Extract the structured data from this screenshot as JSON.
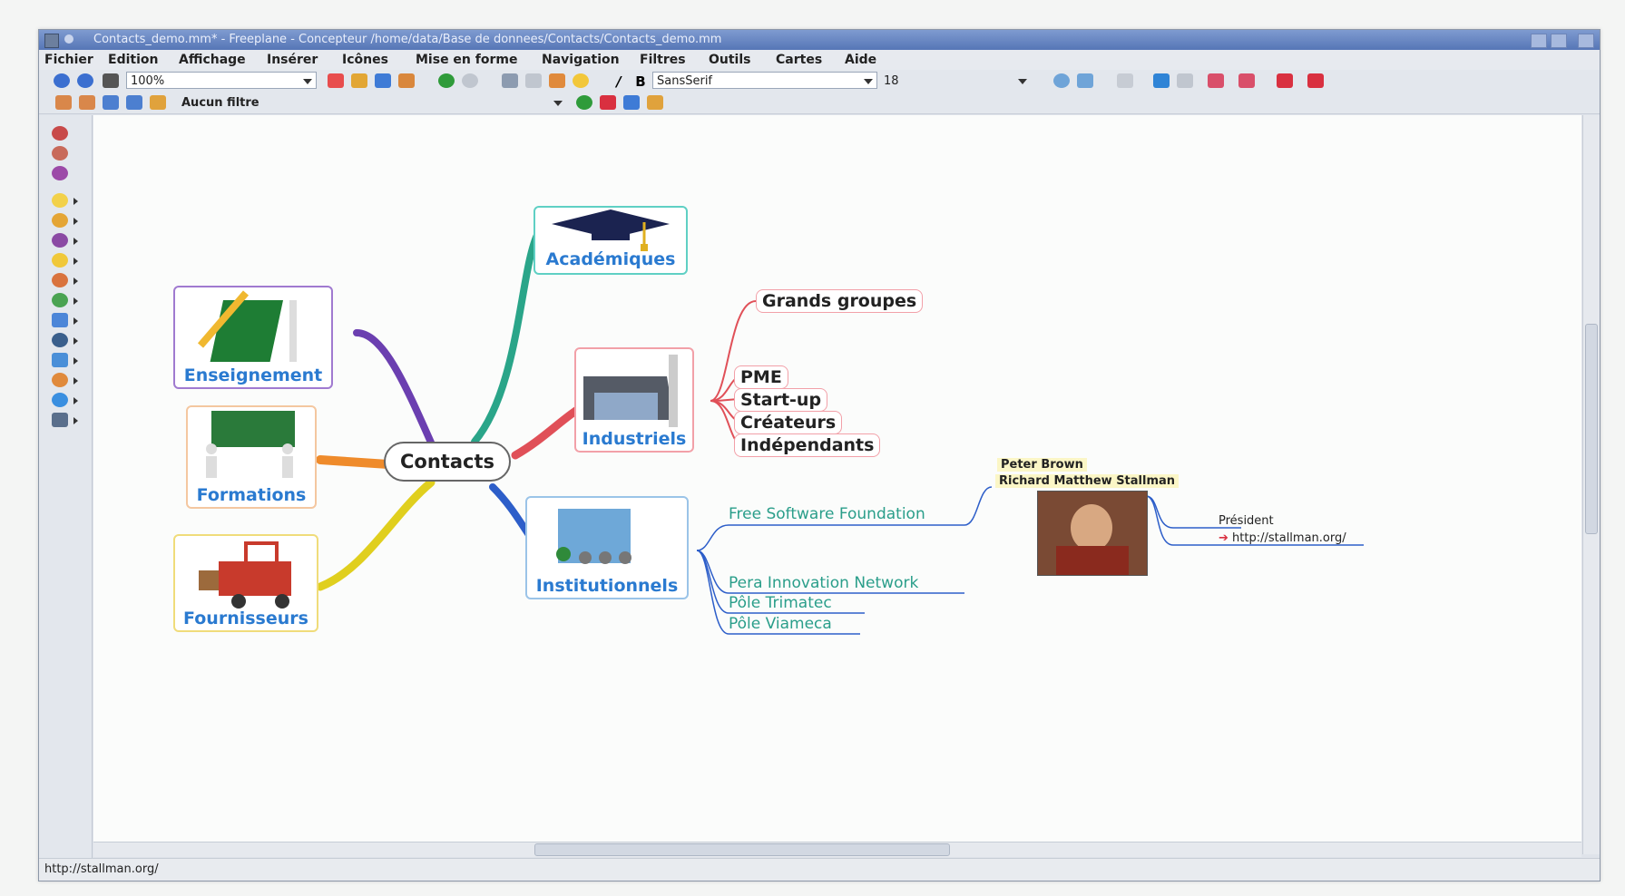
{
  "window": {
    "title": "Contacts_demo.mm* - Freeplane - Concepteur /home/data/Base de donnees/Contacts/Contacts_demo.mm"
  },
  "menu": [
    "Fichier",
    "Edition",
    "Affichage",
    "Insérer",
    "Icônes",
    "Mise en forme",
    "Navigation",
    "Filtres",
    "Outils",
    "Cartes",
    "Aide"
  ],
  "toolbar": {
    "zoom": "100%",
    "font": "SansSerif",
    "font_size": "18",
    "filter": "Aucun filtre"
  },
  "map": {
    "root": "Contacts",
    "academiques": "Académiques",
    "enseignement": "Enseignement",
    "formations": "Formations",
    "fournisseurs": "Fournisseurs",
    "industriels": "Industriels",
    "institutionnels": "Institutionnels",
    "industriels_children": [
      "Grands groupes",
      "PME",
      "Start-up",
      "Créateurs",
      "Indépendants"
    ],
    "institutionnels_children": [
      "Free Software Foundation",
      "Pera Innovation Network",
      "Pôle Trimatec",
      "Pôle Viameca"
    ],
    "person": {
      "name1": "Peter Brown",
      "name2": "Richard Matthew Stallman",
      "role": "Président",
      "link": "http://stallman.org/"
    }
  },
  "status": "http://stallman.org/",
  "colors": {
    "teal": "#2aa589",
    "purple": "#6b3fb0",
    "orange": "#ef8b2b",
    "yellow": "#e0cf1e",
    "red": "#e05058",
    "blue": "#2d5ec9"
  }
}
